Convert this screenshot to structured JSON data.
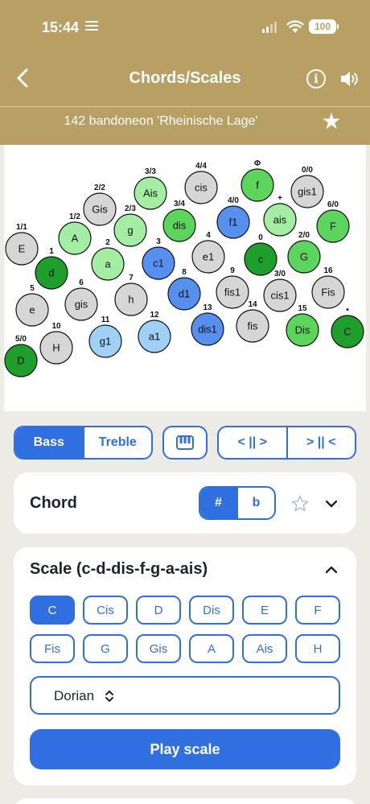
{
  "status": {
    "time": "15:44",
    "battery": "100"
  },
  "nav": {
    "title": "Chords/Scales"
  },
  "instrument": {
    "name": "142 bandoneon 'Rheinische Lage'"
  },
  "colors": {
    "header": "#b8a064",
    "accent": "#2f6fe0",
    "root": "#1e9e2a",
    "scale_green": "#5bd55b",
    "scale_light_green": "#a4eea4",
    "blue": "#5590ee",
    "light_blue": "#9fd0f5",
    "neutral": "#d6d6d6"
  },
  "keyboard": {
    "buttons": [
      {
        "note": "E",
        "num": "1/1",
        "fill": "neutral"
      },
      {
        "note": "d",
        "num": "1",
        "fill": "root"
      },
      {
        "note": "e",
        "num": "5",
        "fill": "neutral"
      },
      {
        "note": "D",
        "num": "5/0",
        "fill": "root"
      },
      {
        "note": "A",
        "num": "1/2",
        "fill": "scale_light_green"
      },
      {
        "note": "gis",
        "num": "6",
        "fill": "neutral"
      },
      {
        "note": "H",
        "num": "10",
        "fill": "neutral"
      },
      {
        "note": "Gis",
        "num": "2/2",
        "fill": "neutral"
      },
      {
        "note": "a",
        "num": "2",
        "fill": "scale_light_green"
      },
      {
        "note": "g1",
        "num": "11",
        "fill": "light_blue"
      },
      {
        "note": "Ais",
        "num": "3/3",
        "fill": "scale_light_green"
      },
      {
        "note": "g",
        "num": "2/3",
        "fill": "scale_light_green"
      },
      {
        "note": "h",
        "num": "7",
        "fill": "neutral"
      },
      {
        "note": "c1",
        "num": "3",
        "fill": "blue"
      },
      {
        "note": "a1",
        "num": "12",
        "fill": "light_blue"
      },
      {
        "note": "cis",
        "num": "4/4",
        "fill": "neutral"
      },
      {
        "note": "dis",
        "num": "3/4",
        "fill": "scale_green"
      },
      {
        "note": "d1",
        "num": "8",
        "fill": "blue"
      },
      {
        "note": "e1",
        "num": "4",
        "fill": "neutral"
      },
      {
        "note": "dis1",
        "num": "13",
        "fill": "blue"
      },
      {
        "note": "f",
        "num": "Φ",
        "fill": "scale_green"
      },
      {
        "note": "f1",
        "num": "4/0",
        "fill": "blue"
      },
      {
        "note": "fis1",
        "num": "9",
        "fill": "neutral"
      },
      {
        "note": "fis",
        "num": "14",
        "fill": "neutral"
      },
      {
        "note": "ais",
        "num": "+",
        "fill": "scale_light_green"
      },
      {
        "note": "c",
        "num": "0",
        "fill": "root"
      },
      {
        "note": "cis1",
        "num": "3/0",
        "fill": "neutral"
      },
      {
        "note": "gis1",
        "num": "0/0",
        "fill": "neutral"
      },
      {
        "note": "G",
        "num": "2/0",
        "fill": "scale_green"
      },
      {
        "note": "Dis",
        "num": "15",
        "fill": "scale_green"
      },
      {
        "note": "F",
        "num": "6/0",
        "fill": "scale_green"
      },
      {
        "note": "Fis",
        "num": "16",
        "fill": "neutral"
      },
      {
        "note": "C",
        "num": "•",
        "fill": "root"
      }
    ]
  },
  "controls": {
    "side": {
      "bass": "Bass",
      "treble": "Treble",
      "selected": "Bass"
    },
    "direction": {
      "push": "< || >",
      "pull": "> || <"
    }
  },
  "chord": {
    "title": "Chord",
    "sharp": "#",
    "flat": "b",
    "selected": "#"
  },
  "scale": {
    "title": "Scale (c-d-dis-f-g-a-ais)",
    "roots": [
      "C",
      "Cis",
      "D",
      "Dis",
      "E",
      "F",
      "Fis",
      "G",
      "Gis",
      "A",
      "Ais",
      "H"
    ],
    "selected_root": "C",
    "mode": "Dorian",
    "play_label": "Play scale"
  }
}
